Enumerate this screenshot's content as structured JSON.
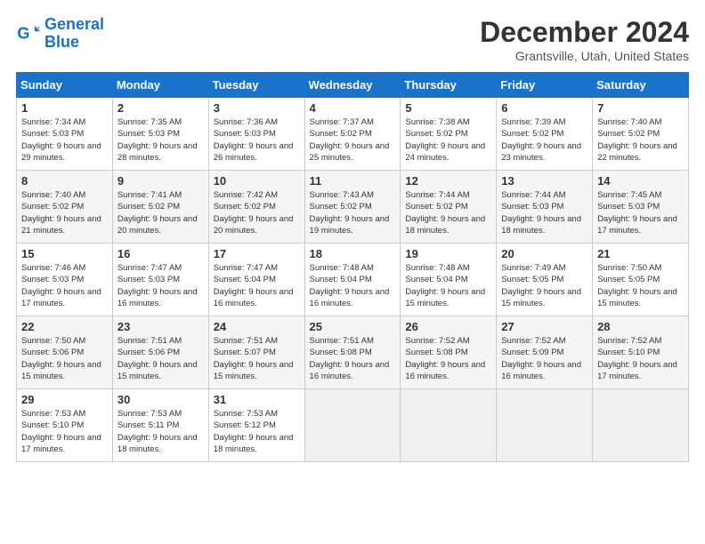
{
  "logo": {
    "line1": "General",
    "line2": "Blue"
  },
  "title": "December 2024",
  "location": "Grantsville, Utah, United States",
  "weekdays": [
    "Sunday",
    "Monday",
    "Tuesday",
    "Wednesday",
    "Thursday",
    "Friday",
    "Saturday"
  ],
  "weeks": [
    [
      {
        "day": 1,
        "sunrise": "7:34 AM",
        "sunset": "5:03 PM",
        "daylight": "9 hours and 29 minutes."
      },
      {
        "day": 2,
        "sunrise": "7:35 AM",
        "sunset": "5:03 PM",
        "daylight": "9 hours and 28 minutes."
      },
      {
        "day": 3,
        "sunrise": "7:36 AM",
        "sunset": "5:03 PM",
        "daylight": "9 hours and 26 minutes."
      },
      {
        "day": 4,
        "sunrise": "7:37 AM",
        "sunset": "5:02 PM",
        "daylight": "9 hours and 25 minutes."
      },
      {
        "day": 5,
        "sunrise": "7:38 AM",
        "sunset": "5:02 PM",
        "daylight": "9 hours and 24 minutes."
      },
      {
        "day": 6,
        "sunrise": "7:39 AM",
        "sunset": "5:02 PM",
        "daylight": "9 hours and 23 minutes."
      },
      {
        "day": 7,
        "sunrise": "7:40 AM",
        "sunset": "5:02 PM",
        "daylight": "9 hours and 22 minutes."
      }
    ],
    [
      {
        "day": 8,
        "sunrise": "7:40 AM",
        "sunset": "5:02 PM",
        "daylight": "9 hours and 21 minutes."
      },
      {
        "day": 9,
        "sunrise": "7:41 AM",
        "sunset": "5:02 PM",
        "daylight": "9 hours and 20 minutes."
      },
      {
        "day": 10,
        "sunrise": "7:42 AM",
        "sunset": "5:02 PM",
        "daylight": "9 hours and 20 minutes."
      },
      {
        "day": 11,
        "sunrise": "7:43 AM",
        "sunset": "5:02 PM",
        "daylight": "9 hours and 19 minutes."
      },
      {
        "day": 12,
        "sunrise": "7:44 AM",
        "sunset": "5:02 PM",
        "daylight": "9 hours and 18 minutes."
      },
      {
        "day": 13,
        "sunrise": "7:44 AM",
        "sunset": "5:03 PM",
        "daylight": "9 hours and 18 minutes."
      },
      {
        "day": 14,
        "sunrise": "7:45 AM",
        "sunset": "5:03 PM",
        "daylight": "9 hours and 17 minutes."
      }
    ],
    [
      {
        "day": 15,
        "sunrise": "7:46 AM",
        "sunset": "5:03 PM",
        "daylight": "9 hours and 17 minutes."
      },
      {
        "day": 16,
        "sunrise": "7:47 AM",
        "sunset": "5:03 PM",
        "daylight": "9 hours and 16 minutes."
      },
      {
        "day": 17,
        "sunrise": "7:47 AM",
        "sunset": "5:04 PM",
        "daylight": "9 hours and 16 minutes."
      },
      {
        "day": 18,
        "sunrise": "7:48 AM",
        "sunset": "5:04 PM",
        "daylight": "9 hours and 16 minutes."
      },
      {
        "day": 19,
        "sunrise": "7:48 AM",
        "sunset": "5:04 PM",
        "daylight": "9 hours and 15 minutes."
      },
      {
        "day": 20,
        "sunrise": "7:49 AM",
        "sunset": "5:05 PM",
        "daylight": "9 hours and 15 minutes."
      },
      {
        "day": 21,
        "sunrise": "7:50 AM",
        "sunset": "5:05 PM",
        "daylight": "9 hours and 15 minutes."
      }
    ],
    [
      {
        "day": 22,
        "sunrise": "7:50 AM",
        "sunset": "5:06 PM",
        "daylight": "9 hours and 15 minutes."
      },
      {
        "day": 23,
        "sunrise": "7:51 AM",
        "sunset": "5:06 PM",
        "daylight": "9 hours and 15 minutes."
      },
      {
        "day": 24,
        "sunrise": "7:51 AM",
        "sunset": "5:07 PM",
        "daylight": "9 hours and 15 minutes."
      },
      {
        "day": 25,
        "sunrise": "7:51 AM",
        "sunset": "5:08 PM",
        "daylight": "9 hours and 16 minutes."
      },
      {
        "day": 26,
        "sunrise": "7:52 AM",
        "sunset": "5:08 PM",
        "daylight": "9 hours and 16 minutes."
      },
      {
        "day": 27,
        "sunrise": "7:52 AM",
        "sunset": "5:09 PM",
        "daylight": "9 hours and 16 minutes."
      },
      {
        "day": 28,
        "sunrise": "7:52 AM",
        "sunset": "5:10 PM",
        "daylight": "9 hours and 17 minutes."
      }
    ],
    [
      {
        "day": 29,
        "sunrise": "7:53 AM",
        "sunset": "5:10 PM",
        "daylight": "9 hours and 17 minutes."
      },
      {
        "day": 30,
        "sunrise": "7:53 AM",
        "sunset": "5:11 PM",
        "daylight": "9 hours and 18 minutes."
      },
      {
        "day": 31,
        "sunrise": "7:53 AM",
        "sunset": "5:12 PM",
        "daylight": "9 hours and 18 minutes."
      },
      null,
      null,
      null,
      null
    ]
  ]
}
